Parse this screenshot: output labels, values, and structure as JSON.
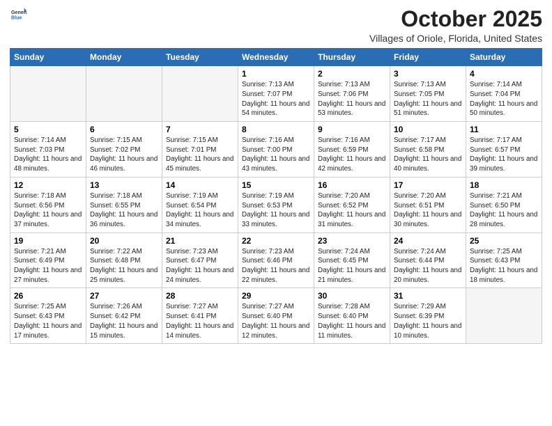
{
  "header": {
    "logo_general": "General",
    "logo_blue": "Blue",
    "month": "October 2025",
    "location": "Villages of Oriole, Florida, United States"
  },
  "weekdays": [
    "Sunday",
    "Monday",
    "Tuesday",
    "Wednesday",
    "Thursday",
    "Friday",
    "Saturday"
  ],
  "weeks": [
    [
      {
        "day": "",
        "sunrise": "",
        "sunset": "",
        "daylight": ""
      },
      {
        "day": "",
        "sunrise": "",
        "sunset": "",
        "daylight": ""
      },
      {
        "day": "",
        "sunrise": "",
        "sunset": "",
        "daylight": ""
      },
      {
        "day": "1",
        "sunrise": "Sunrise: 7:13 AM",
        "sunset": "Sunset: 7:07 PM",
        "daylight": "Daylight: 11 hours and 54 minutes."
      },
      {
        "day": "2",
        "sunrise": "Sunrise: 7:13 AM",
        "sunset": "Sunset: 7:06 PM",
        "daylight": "Daylight: 11 hours and 53 minutes."
      },
      {
        "day": "3",
        "sunrise": "Sunrise: 7:13 AM",
        "sunset": "Sunset: 7:05 PM",
        "daylight": "Daylight: 11 hours and 51 minutes."
      },
      {
        "day": "4",
        "sunrise": "Sunrise: 7:14 AM",
        "sunset": "Sunset: 7:04 PM",
        "daylight": "Daylight: 11 hours and 50 minutes."
      }
    ],
    [
      {
        "day": "5",
        "sunrise": "Sunrise: 7:14 AM",
        "sunset": "Sunset: 7:03 PM",
        "daylight": "Daylight: 11 hours and 48 minutes."
      },
      {
        "day": "6",
        "sunrise": "Sunrise: 7:15 AM",
        "sunset": "Sunset: 7:02 PM",
        "daylight": "Daylight: 11 hours and 46 minutes."
      },
      {
        "day": "7",
        "sunrise": "Sunrise: 7:15 AM",
        "sunset": "Sunset: 7:01 PM",
        "daylight": "Daylight: 11 hours and 45 minutes."
      },
      {
        "day": "8",
        "sunrise": "Sunrise: 7:16 AM",
        "sunset": "Sunset: 7:00 PM",
        "daylight": "Daylight: 11 hours and 43 minutes."
      },
      {
        "day": "9",
        "sunrise": "Sunrise: 7:16 AM",
        "sunset": "Sunset: 6:59 PM",
        "daylight": "Daylight: 11 hours and 42 minutes."
      },
      {
        "day": "10",
        "sunrise": "Sunrise: 7:17 AM",
        "sunset": "Sunset: 6:58 PM",
        "daylight": "Daylight: 11 hours and 40 minutes."
      },
      {
        "day": "11",
        "sunrise": "Sunrise: 7:17 AM",
        "sunset": "Sunset: 6:57 PM",
        "daylight": "Daylight: 11 hours and 39 minutes."
      }
    ],
    [
      {
        "day": "12",
        "sunrise": "Sunrise: 7:18 AM",
        "sunset": "Sunset: 6:56 PM",
        "daylight": "Daylight: 11 hours and 37 minutes."
      },
      {
        "day": "13",
        "sunrise": "Sunrise: 7:18 AM",
        "sunset": "Sunset: 6:55 PM",
        "daylight": "Daylight: 11 hours and 36 minutes."
      },
      {
        "day": "14",
        "sunrise": "Sunrise: 7:19 AM",
        "sunset": "Sunset: 6:54 PM",
        "daylight": "Daylight: 11 hours and 34 minutes."
      },
      {
        "day": "15",
        "sunrise": "Sunrise: 7:19 AM",
        "sunset": "Sunset: 6:53 PM",
        "daylight": "Daylight: 11 hours and 33 minutes."
      },
      {
        "day": "16",
        "sunrise": "Sunrise: 7:20 AM",
        "sunset": "Sunset: 6:52 PM",
        "daylight": "Daylight: 11 hours and 31 minutes."
      },
      {
        "day": "17",
        "sunrise": "Sunrise: 7:20 AM",
        "sunset": "Sunset: 6:51 PM",
        "daylight": "Daylight: 11 hours and 30 minutes."
      },
      {
        "day": "18",
        "sunrise": "Sunrise: 7:21 AM",
        "sunset": "Sunset: 6:50 PM",
        "daylight": "Daylight: 11 hours and 28 minutes."
      }
    ],
    [
      {
        "day": "19",
        "sunrise": "Sunrise: 7:21 AM",
        "sunset": "Sunset: 6:49 PM",
        "daylight": "Daylight: 11 hours and 27 minutes."
      },
      {
        "day": "20",
        "sunrise": "Sunrise: 7:22 AM",
        "sunset": "Sunset: 6:48 PM",
        "daylight": "Daylight: 11 hours and 25 minutes."
      },
      {
        "day": "21",
        "sunrise": "Sunrise: 7:23 AM",
        "sunset": "Sunset: 6:47 PM",
        "daylight": "Daylight: 11 hours and 24 minutes."
      },
      {
        "day": "22",
        "sunrise": "Sunrise: 7:23 AM",
        "sunset": "Sunset: 6:46 PM",
        "daylight": "Daylight: 11 hours and 22 minutes."
      },
      {
        "day": "23",
        "sunrise": "Sunrise: 7:24 AM",
        "sunset": "Sunset: 6:45 PM",
        "daylight": "Daylight: 11 hours and 21 minutes."
      },
      {
        "day": "24",
        "sunrise": "Sunrise: 7:24 AM",
        "sunset": "Sunset: 6:44 PM",
        "daylight": "Daylight: 11 hours and 20 minutes."
      },
      {
        "day": "25",
        "sunrise": "Sunrise: 7:25 AM",
        "sunset": "Sunset: 6:43 PM",
        "daylight": "Daylight: 11 hours and 18 minutes."
      }
    ],
    [
      {
        "day": "26",
        "sunrise": "Sunrise: 7:25 AM",
        "sunset": "Sunset: 6:43 PM",
        "daylight": "Daylight: 11 hours and 17 minutes."
      },
      {
        "day": "27",
        "sunrise": "Sunrise: 7:26 AM",
        "sunset": "Sunset: 6:42 PM",
        "daylight": "Daylight: 11 hours and 15 minutes."
      },
      {
        "day": "28",
        "sunrise": "Sunrise: 7:27 AM",
        "sunset": "Sunset: 6:41 PM",
        "daylight": "Daylight: 11 hours and 14 minutes."
      },
      {
        "day": "29",
        "sunrise": "Sunrise: 7:27 AM",
        "sunset": "Sunset: 6:40 PM",
        "daylight": "Daylight: 11 hours and 12 minutes."
      },
      {
        "day": "30",
        "sunrise": "Sunrise: 7:28 AM",
        "sunset": "Sunset: 6:40 PM",
        "daylight": "Daylight: 11 hours and 11 minutes."
      },
      {
        "day": "31",
        "sunrise": "Sunrise: 7:29 AM",
        "sunset": "Sunset: 6:39 PM",
        "daylight": "Daylight: 11 hours and 10 minutes."
      },
      {
        "day": "",
        "sunrise": "",
        "sunset": "",
        "daylight": ""
      }
    ]
  ]
}
